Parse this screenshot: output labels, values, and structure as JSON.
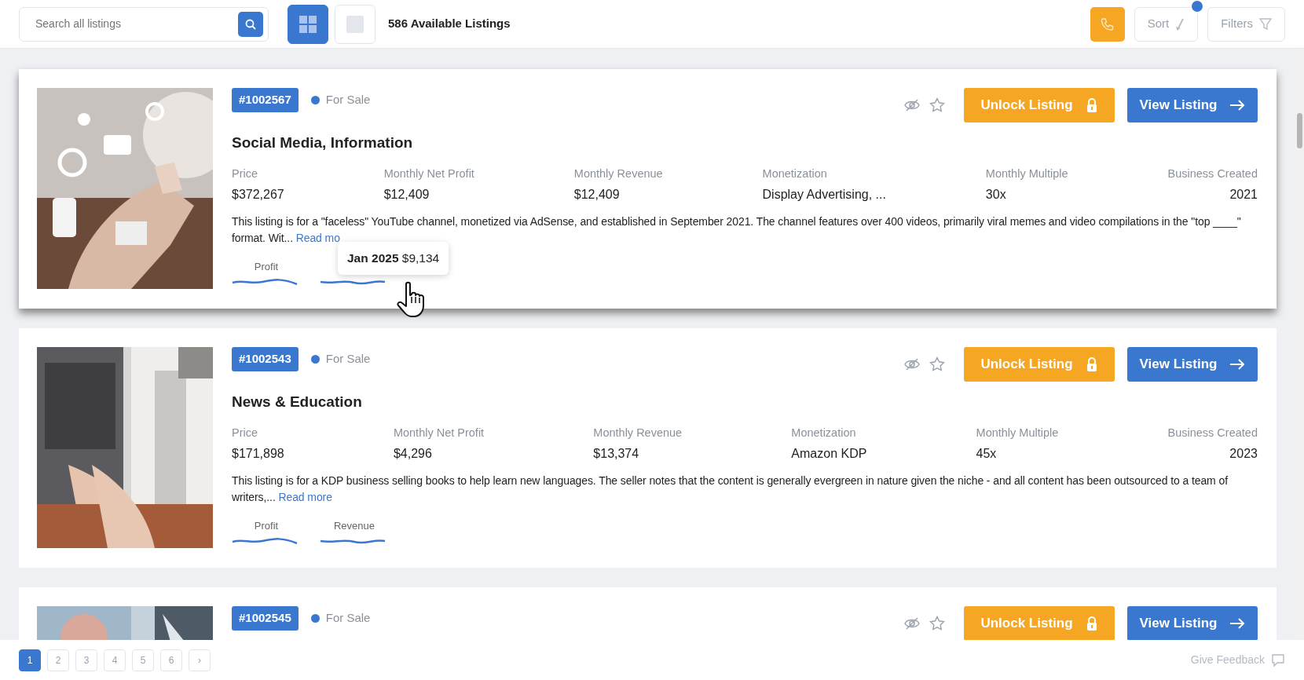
{
  "search": {
    "placeholder": "Search all listings"
  },
  "view_toggle": [
    {
      "kind": "grid",
      "selected": true
    },
    {
      "kind": "list",
      "selected": false
    }
  ],
  "listing_count": "586 Available Listings",
  "sort": {
    "label": "Sort",
    "active": true
  },
  "filters": {
    "label": "Filters"
  },
  "listings": [
    {
      "id": "#1002567",
      "status": "For Sale",
      "color": "#3a78d0",
      "title": "Social Media, Information",
      "hovered": true,
      "metrics": [
        {
          "label": "Price",
          "value": "$372,267"
        },
        {
          "label": "Monthly Net Profit",
          "value": "$12,409"
        },
        {
          "label": "Monthly Revenue",
          "value": "$12,409"
        },
        {
          "label": "Monetization",
          "value": "Display Advertising, ..."
        },
        {
          "label": "Monthly Multiple",
          "value": "30x"
        },
        {
          "label": "Business Created",
          "value": "2021"
        }
      ],
      "description": "This listing is for a \"faceless\" YouTube channel, monetized via AdSense, and established in September 2021. The channel features over 400 videos, primarily viral memes and video compilations in the \"top ____\" format. Wit...",
      "read_more": "Read mo",
      "sparklines": [
        {
          "label": "Profit"
        },
        {
          "tooltip": {
            "period": "Jan 2025",
            "value": "$9,134"
          }
        }
      ],
      "unlock": "Unlock Listing",
      "view": "View Listing"
    },
    {
      "id": "#1002543",
      "status": "For Sale",
      "color": "#3a78d0",
      "title": "News & Education",
      "hovered": false,
      "metrics": [
        {
          "label": "Price",
          "value": "$171,898"
        },
        {
          "label": "Monthly Net Profit",
          "value": "$4,296"
        },
        {
          "label": "Monthly Revenue",
          "value": "$13,374"
        },
        {
          "label": "Monetization",
          "value": "Amazon KDP"
        },
        {
          "label": "Monthly Multiple",
          "value": "45x"
        },
        {
          "label": "Business Created",
          "value": "2023"
        }
      ],
      "description": "This listing is for a KDP business selling books to help learn new languages. The seller notes that the content is generally evergreen in nature given the niche - and all content has been outsourced to a team of writers,...",
      "read_more": "Read more",
      "sparklines": [
        {
          "label": "Profit"
        },
        {
          "label": "Revenue"
        }
      ],
      "unlock": "Unlock Listing",
      "view": "View Listing"
    },
    {
      "id": "#1002545",
      "status": "For Sale",
      "color": "#3a78d0",
      "hovered": false,
      "unlock": "Unlock Listing",
      "view": "View Listing"
    }
  ],
  "pagination": [
    {
      "label": "1",
      "selected": true
    },
    {
      "label": "2",
      "selected": false
    },
    {
      "label": "3",
      "selected": false
    },
    {
      "label": "4",
      "selected": false
    },
    {
      "label": "5",
      "selected": false
    },
    {
      "label": "6",
      "selected": false
    },
    {
      "label": "›",
      "selected": false
    }
  ],
  "feedback": "Give Feedback"
}
